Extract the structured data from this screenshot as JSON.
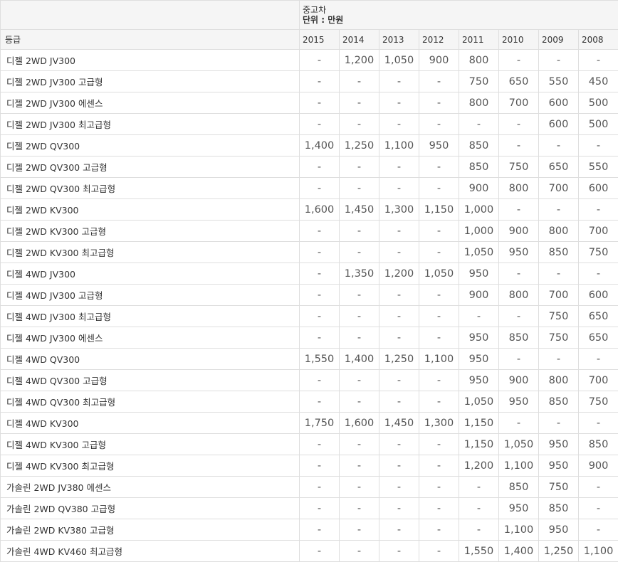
{
  "caption": {
    "line1": "중고차",
    "line2": "단위 : 만원"
  },
  "header": {
    "grade_label": "등급",
    "years": [
      "2015",
      "2014",
      "2013",
      "2012",
      "2011",
      "2010",
      "2009",
      "2008"
    ]
  },
  "rows": [
    {
      "grade": "디젤 2WD JV300",
      "values": [
        "-",
        "1,200",
        "1,050",
        "900",
        "800",
        "-",
        "-",
        "-"
      ]
    },
    {
      "grade": "디젤 2WD JV300 고급형",
      "values": [
        "-",
        "-",
        "-",
        "-",
        "750",
        "650",
        "550",
        "450"
      ]
    },
    {
      "grade": "디젤 2WD JV300 에센스",
      "values": [
        "-",
        "-",
        "-",
        "-",
        "800",
        "700",
        "600",
        "500"
      ]
    },
    {
      "grade": "디젤 2WD JV300 최고급형",
      "values": [
        "-",
        "-",
        "-",
        "-",
        "-",
        "-",
        "600",
        "500"
      ]
    },
    {
      "grade": "디젤 2WD QV300",
      "values": [
        "1,400",
        "1,250",
        "1,100",
        "950",
        "850",
        "-",
        "-",
        "-"
      ]
    },
    {
      "grade": "디젤 2WD QV300 고급형",
      "values": [
        "-",
        "-",
        "-",
        "-",
        "850",
        "750",
        "650",
        "550"
      ]
    },
    {
      "grade": "디젤 2WD QV300 최고급형",
      "values": [
        "-",
        "-",
        "-",
        "-",
        "900",
        "800",
        "700",
        "600"
      ]
    },
    {
      "grade": "디젤 2WD KV300",
      "values": [
        "1,600",
        "1,450",
        "1,300",
        "1,150",
        "1,000",
        "-",
        "-",
        "-"
      ]
    },
    {
      "grade": "디젤 2WD KV300 고급형",
      "values": [
        "-",
        "-",
        "-",
        "-",
        "1,000",
        "900",
        "800",
        "700"
      ]
    },
    {
      "grade": "디젤 2WD KV300 최고급형",
      "values": [
        "-",
        "-",
        "-",
        "-",
        "1,050",
        "950",
        "850",
        "750"
      ]
    },
    {
      "grade": "디젤 4WD JV300",
      "values": [
        "-",
        "1,350",
        "1,200",
        "1,050",
        "950",
        "-",
        "-",
        "-"
      ]
    },
    {
      "grade": "디젤 4WD JV300 고급형",
      "values": [
        "-",
        "-",
        "-",
        "-",
        "900",
        "800",
        "700",
        "600"
      ]
    },
    {
      "grade": "디젤 4WD JV300 최고급형",
      "values": [
        "-",
        "-",
        "-",
        "-",
        "-",
        "-",
        "750",
        "650"
      ]
    },
    {
      "grade": "디젤 4WD JV300 에센스",
      "values": [
        "-",
        "-",
        "-",
        "-",
        "950",
        "850",
        "750",
        "650"
      ]
    },
    {
      "grade": "디젤 4WD QV300",
      "values": [
        "1,550",
        "1,400",
        "1,250",
        "1,100",
        "950",
        "-",
        "-",
        "-"
      ]
    },
    {
      "grade": "디젤 4WD QV300 고급형",
      "values": [
        "-",
        "-",
        "-",
        "-",
        "950",
        "900",
        "800",
        "700"
      ]
    },
    {
      "grade": "디젤 4WD QV300 최고급형",
      "values": [
        "-",
        "-",
        "-",
        "-",
        "1,050",
        "950",
        "850",
        "750"
      ]
    },
    {
      "grade": "디젤 4WD KV300",
      "values": [
        "1,750",
        "1,600",
        "1,450",
        "1,300",
        "1,150",
        "-",
        "-",
        "-"
      ]
    },
    {
      "grade": "디젤 4WD KV300 고급형",
      "values": [
        "-",
        "-",
        "-",
        "-",
        "1,150",
        "1,050",
        "950",
        "850"
      ]
    },
    {
      "grade": "디젤 4WD KV300 최고급형",
      "values": [
        "-",
        "-",
        "-",
        "-",
        "1,200",
        "1,100",
        "950",
        "900"
      ]
    },
    {
      "grade": "가솔린 2WD JV380 에센스",
      "values": [
        "-",
        "-",
        "-",
        "-",
        "-",
        "850",
        "750",
        "-"
      ]
    },
    {
      "grade": "가솔린 2WD QV380 고급형",
      "values": [
        "-",
        "-",
        "-",
        "-",
        "-",
        "950",
        "850",
        "-"
      ]
    },
    {
      "grade": "가솔린 2WD KV380 고급형",
      "values": [
        "-",
        "-",
        "-",
        "-",
        "-",
        "1,100",
        "950",
        "-"
      ]
    },
    {
      "grade": "가솔린 4WD KV460 최고급형",
      "values": [
        "-",
        "-",
        "-",
        "-",
        "1,550",
        "1,400",
        "1,250",
        "1,100"
      ]
    }
  ]
}
